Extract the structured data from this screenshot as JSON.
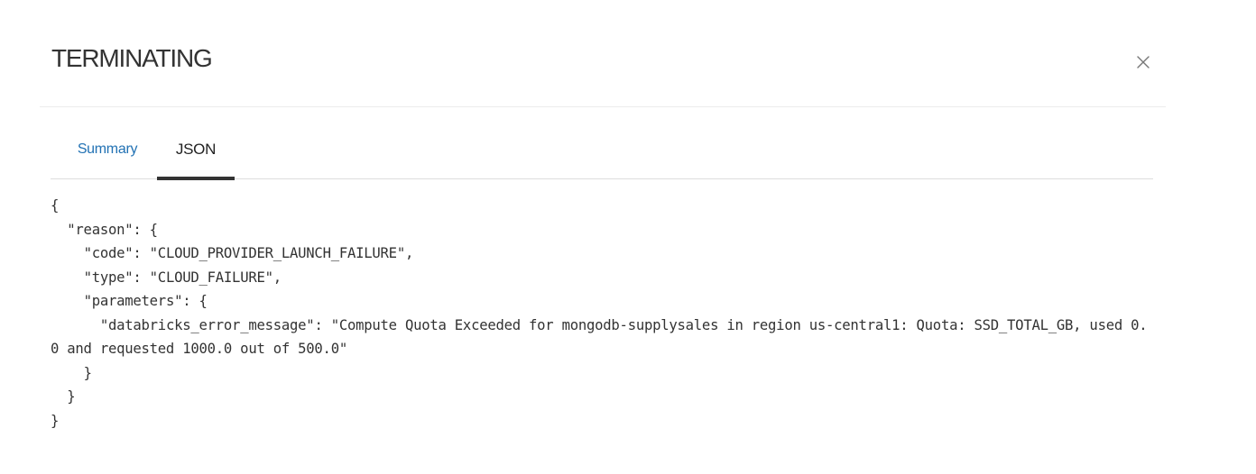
{
  "modal": {
    "title": "TERMINATING",
    "close_icon": "close-icon"
  },
  "tabs": [
    {
      "label": "Summary",
      "active": false
    },
    {
      "label": "JSON",
      "active": true
    }
  ],
  "json_text": "{\n  \"reason\": {\n    \"code\": \"CLOUD_PROVIDER_LAUNCH_FAILURE\",\n    \"type\": \"CLOUD_FAILURE\",\n    \"parameters\": {\n      \"databricks_error_message\": \"Compute Quota Exceeded for mongodb-supplysales in region us-central1: Quota: SSD_TOTAL_GB, used 0.0 and requested 1000.0 out of 500.0\"\n    }\n  }\n}",
  "colors": {
    "link": "#2272b4",
    "active_tab": "#222222",
    "indicator": "#333333",
    "divider": "#dddddd"
  }
}
